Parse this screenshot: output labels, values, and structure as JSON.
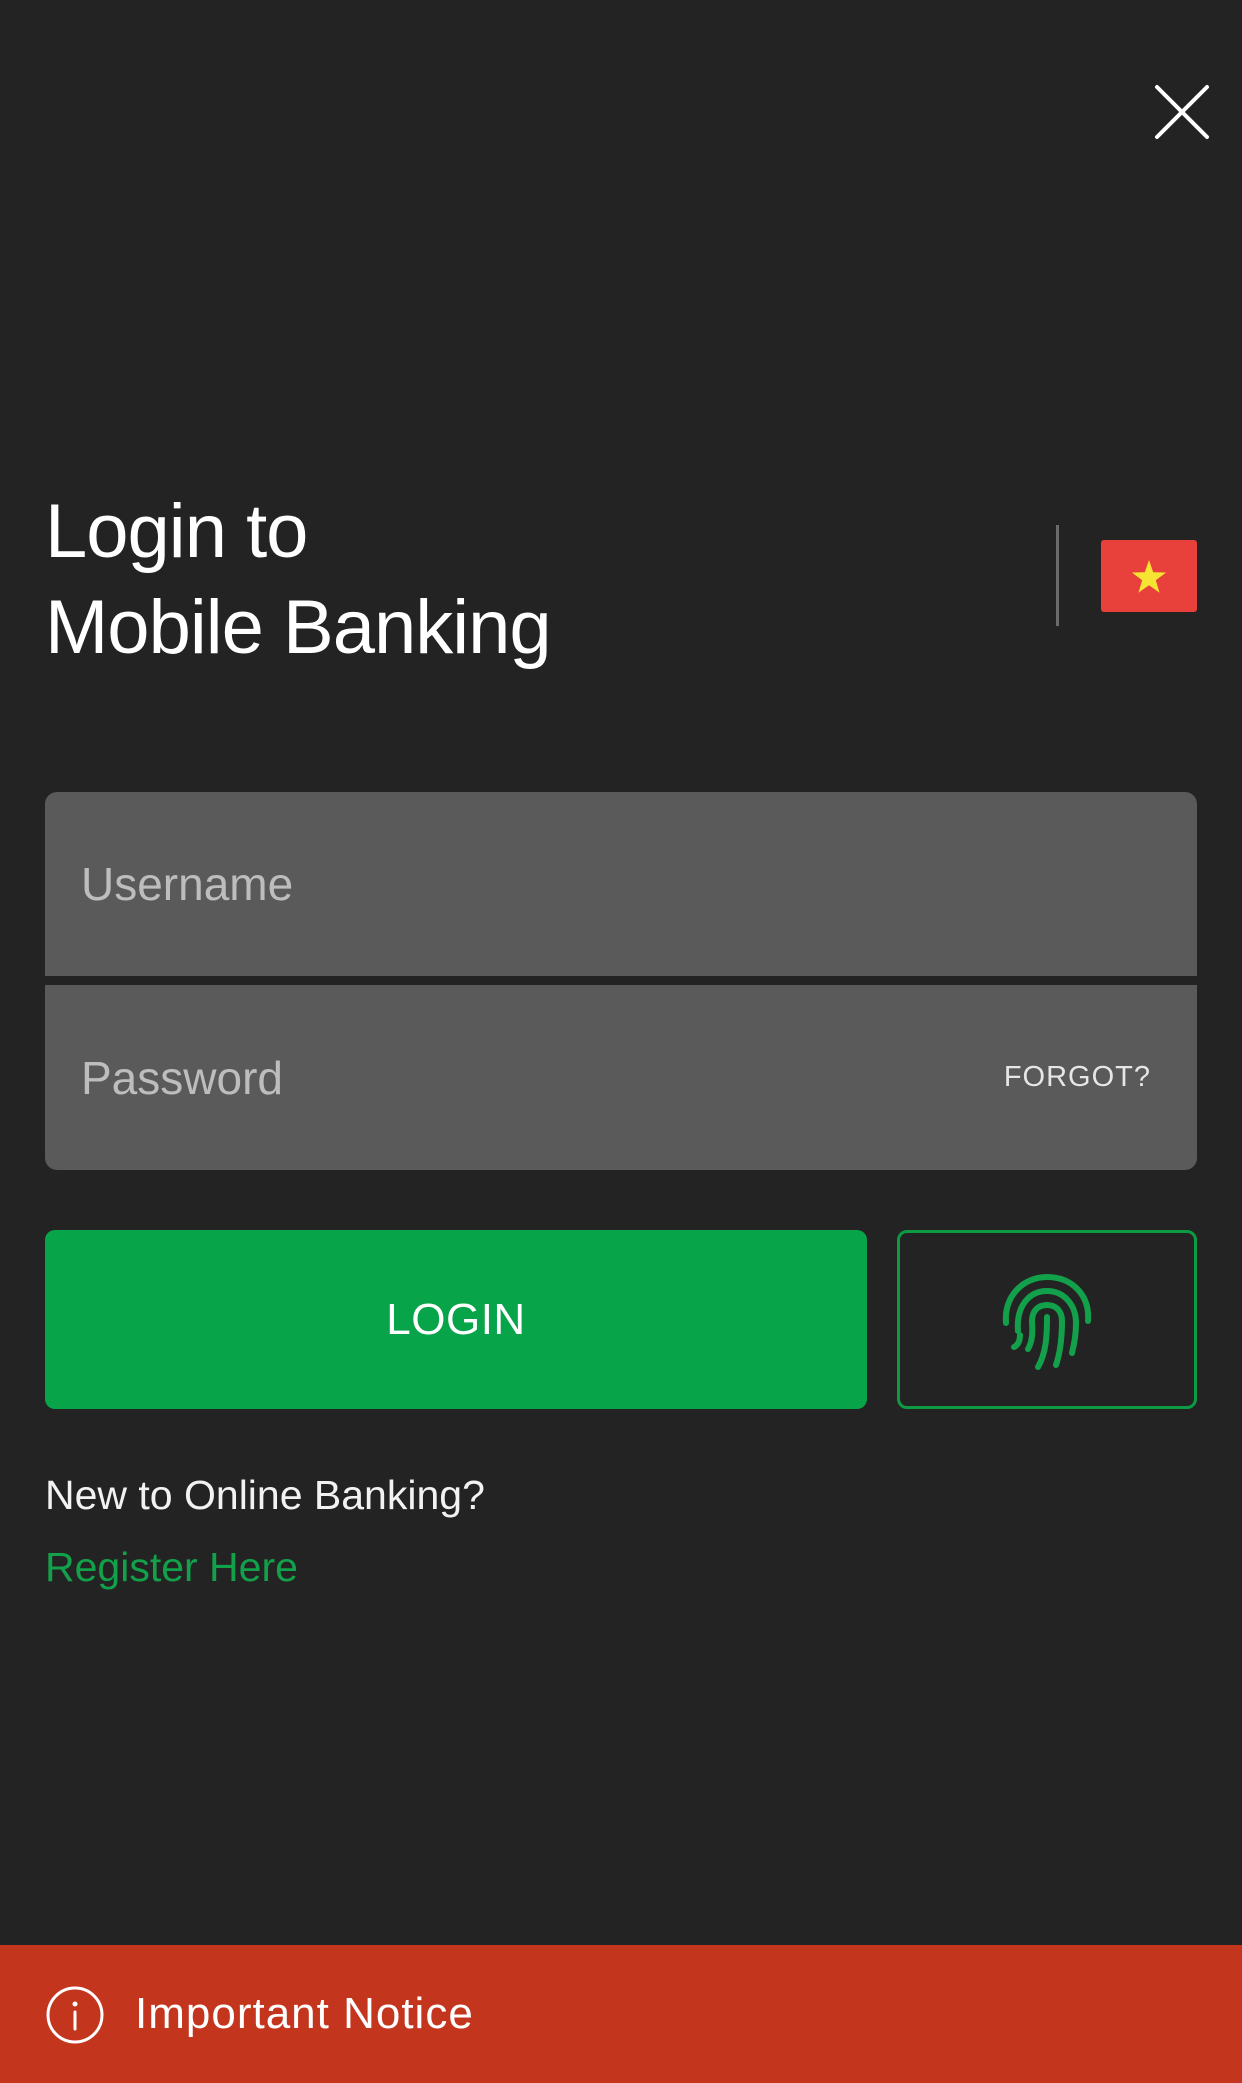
{
  "header": {
    "close_icon": "close-icon"
  },
  "title": {
    "line1": "Login to",
    "line2": "Mobile Banking"
  },
  "region": {
    "flag_icon": "vietnam-flag-icon",
    "flag_color": "#e8403b",
    "star_color": "#f5e532"
  },
  "form": {
    "username_placeholder": "Username",
    "password_placeholder": "Password",
    "forgot_label": "FORGOT?",
    "login_label": "LOGIN",
    "biometric_icon": "fingerprint-icon"
  },
  "register": {
    "prompt": "New to Online Banking?",
    "link_label": "Register Here"
  },
  "notice": {
    "icon": "info-icon",
    "label": "Important Notice"
  },
  "colors": {
    "background": "#232323",
    "field": "#5a5a5a",
    "accent_green": "#08a44a",
    "notice_red": "#c4351e"
  }
}
